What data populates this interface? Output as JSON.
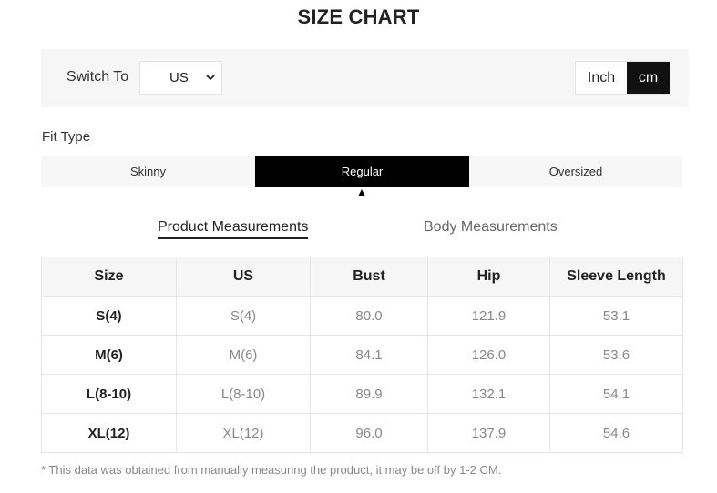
{
  "title": "SIZE CHART",
  "switch": {
    "label": "Switch To",
    "selected": "US",
    "units": {
      "inch": "Inch",
      "cm": "cm",
      "active": "cm"
    }
  },
  "fit": {
    "label": "Fit Type",
    "options": [
      "Skinny",
      "Regular",
      "Oversized"
    ],
    "active": "Regular"
  },
  "tabs": {
    "product": "Product Measurements",
    "body": "Body Measurements",
    "active": "Product Measurements"
  },
  "table": {
    "headers": [
      "Size",
      "US",
      "Bust",
      "Hip",
      "Sleeve Length"
    ],
    "rows": [
      [
        "S(4)",
        "S(4)",
        "80.0",
        "121.9",
        "53.1"
      ],
      [
        "M(6)",
        "M(6)",
        "84.1",
        "126.0",
        "53.6"
      ],
      [
        "L(8-10)",
        "L(8-10)",
        "89.9",
        "132.1",
        "54.1"
      ],
      [
        "XL(12)",
        "XL(12)",
        "96.0",
        "137.9",
        "54.6"
      ]
    ]
  },
  "footnote": "* This data was obtained from manually measuring the product, it may be off by 1-2 CM.",
  "colors": {
    "active_bg": "#000000",
    "panel_bg": "#f6f6f6",
    "muted_text": "#888888"
  }
}
